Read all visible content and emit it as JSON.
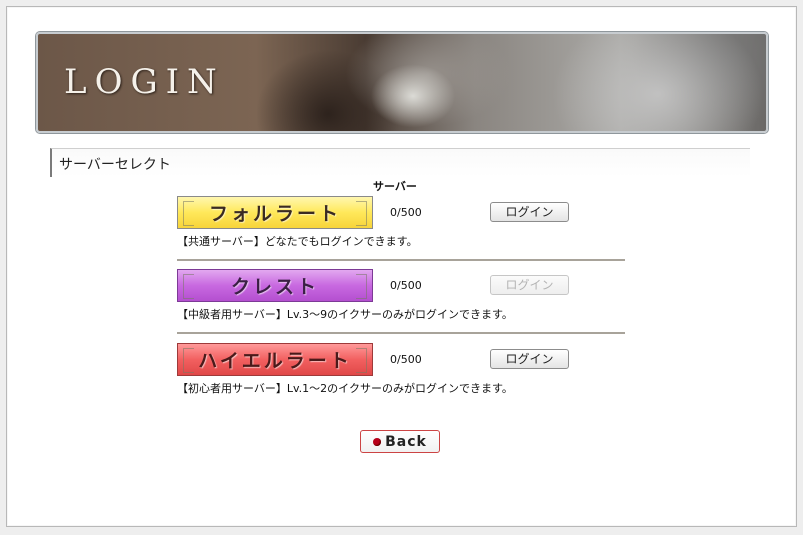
{
  "banner": {
    "title": "LOGIN"
  },
  "section": {
    "title": "サーバーセレクト"
  },
  "column_header": "サーバー",
  "servers": [
    {
      "name": "フォルラート",
      "count": "0/500",
      "login_label": "ログイン",
      "login_enabled": true,
      "description": "【共通サーバー】どなたでもログインできます。",
      "color": "#ffe85a"
    },
    {
      "name": "クレスト",
      "count": "0/500",
      "login_label": "ログイン",
      "login_enabled": false,
      "description": "【中級者用サーバー】Lv.3～9のイクサーのみがログインできます。",
      "color": "#c869e0"
    },
    {
      "name": "ハイエルラート",
      "count": "0/500",
      "login_label": "ログイン",
      "login_enabled": true,
      "description": "【初心者用サーバー】Lv.1～2のイクサーのみがログインできます。",
      "color": "#f26060"
    }
  ],
  "back": {
    "label": "Back",
    "icon": "red-dot-icon"
  }
}
